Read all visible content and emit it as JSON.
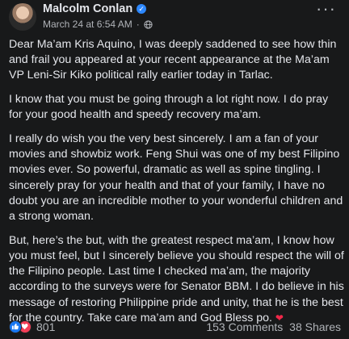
{
  "post": {
    "author": "Malcolm Conlan",
    "date": "March 24 at 6:54 AM",
    "separator": "·",
    "paragraphs": [
      "Dear Ma’am Kris Aquino, I was deeply saddened to see how thin and frail you appeared at your recent appearance at the Ma’am VP Leni-Sir Kiko political rally earlier today in Tarlac.",
      "I know that you must be going through a lot right now. I do pray for your good health and speedy recovery ma’am.",
      "I really do wish you the very best sincerely. I am a fan of your movies and showbiz work. Feng Shui was one of my best Filipino movies ever. So powerful, dramatic as well as spine tingling. I sincerely pray for your health and that of your family, I have no doubt you are an incredible mother to your wonderful children and a strong woman.",
      "But, here’s the but, with the greatest respect ma’am, I know how you must feel, but I sincerely believe you should respect the will of the Filipino people. Last time I checked ma’am, the majority according to the surveys were for Senator BBM. I do believe in his message of restoring Philippine pride and unity, that he is the best for the country. Take care ma’am and God Bless po."
    ],
    "emoji": "❤"
  },
  "reactions": {
    "count": "801",
    "icons": [
      "like-icon",
      "love-icon"
    ]
  },
  "stats": {
    "comments": "153 Comments",
    "shares": "38 Shares"
  },
  "icons": {
    "verified": "verified-badge-icon",
    "privacy": "globe-icon",
    "more": "more-options-icon"
  },
  "colors": {
    "background": "#18191a",
    "text": "#e4e6eb",
    "secondary": "#b0b3b8",
    "accent": "#2d88ff",
    "love": "#f33e58"
  }
}
